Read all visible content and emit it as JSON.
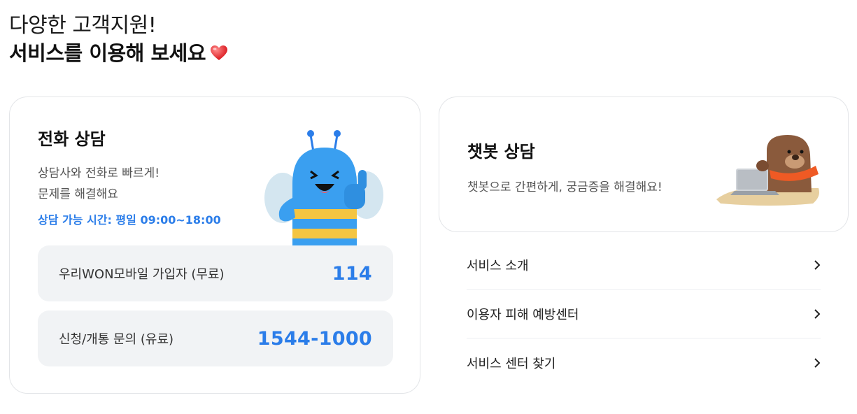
{
  "headline": {
    "line1": "다양한 고객지원!",
    "line2": "서비스를 이용해 보세요"
  },
  "phone": {
    "title": "전화 상담",
    "desc_line1": "상담사와 전화로 빠르게!",
    "desc_line2": "문제를 해결해요",
    "hours": "상담 가능 시간: 평일 09:00~18:00",
    "rows": [
      {
        "label": "우리WON모바일 가입자 (무료)",
        "number": "114"
      },
      {
        "label": "신청/개통 문의 (유료)",
        "number": "1544-1000"
      }
    ]
  },
  "chatbot": {
    "title": "챗봇 상담",
    "desc": "챗봇으로 간편하게, 궁금증을 해결해요!"
  },
  "links": [
    {
      "label": "서비스 소개"
    },
    {
      "label": "이용자 피해 예방센터"
    },
    {
      "label": "서비스 센터 찾기"
    }
  ],
  "colors": {
    "accent": "#2b7de9",
    "row_bg": "#f1f3f5",
    "border": "#e3e5e8"
  },
  "icons": {
    "heart": "heart-icon",
    "chevron": "chevron-right-icon"
  }
}
